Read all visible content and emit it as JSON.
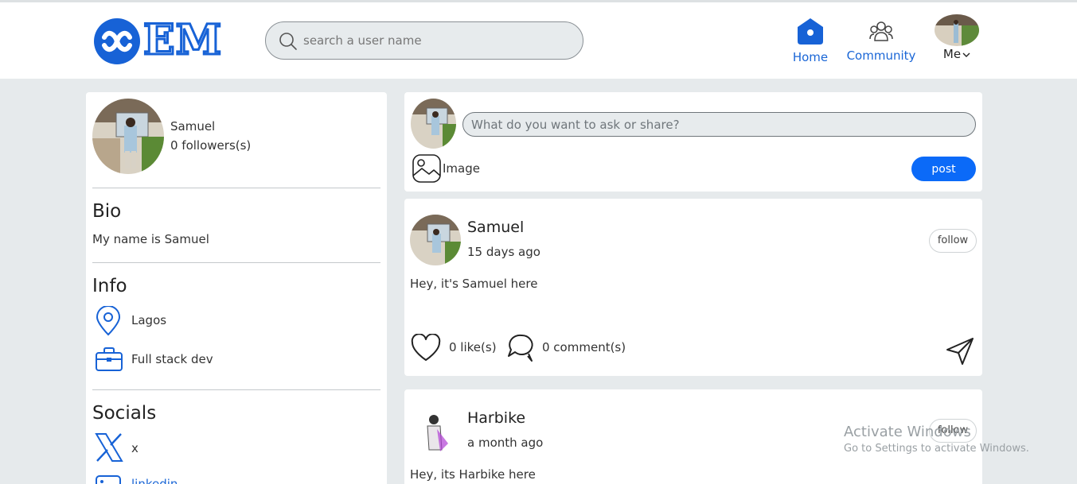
{
  "app": {
    "logo_text": "EM"
  },
  "search": {
    "placeholder": "search a user name"
  },
  "nav": {
    "home": "Home",
    "community": "Community",
    "me": "Me"
  },
  "profile": {
    "name": "Samuel",
    "followers": "0 followers(s)",
    "bio_heading": "Bio",
    "bio": "My name is Samuel",
    "info_heading": "Info",
    "location": "Lagos",
    "job": "Full stack dev",
    "socials_heading": "Socials",
    "social_x": "x",
    "social_linkedin": "linkedin"
  },
  "composer": {
    "placeholder": "What do you want to ask or share?",
    "image_label": "Image",
    "post_label": "post"
  },
  "posts": [
    {
      "author": "Samuel",
      "time": "15 days ago",
      "follow": "follow",
      "text": "Hey, it's Samuel here",
      "likes": "0 like(s)",
      "comments": "0 comment(s)"
    },
    {
      "author": "Harbike",
      "time": "a month ago",
      "follow": "follow",
      "text": "Hey, its Harbike here"
    }
  ],
  "watermark": {
    "title": "Activate Windows",
    "subtitle": "Go to Settings to activate Windows."
  },
  "colors": {
    "brand": "#1762d6",
    "post_button": "#0b6af8",
    "page_bg": "#e6eaec"
  },
  "icons": [
    "search-icon",
    "home-icon",
    "community-icon",
    "chevron-down-icon",
    "location-pin-icon",
    "briefcase-icon",
    "x-logo-icon",
    "linkedin-icon",
    "image-icon",
    "heart-icon",
    "comment-icon",
    "send-icon"
  ]
}
